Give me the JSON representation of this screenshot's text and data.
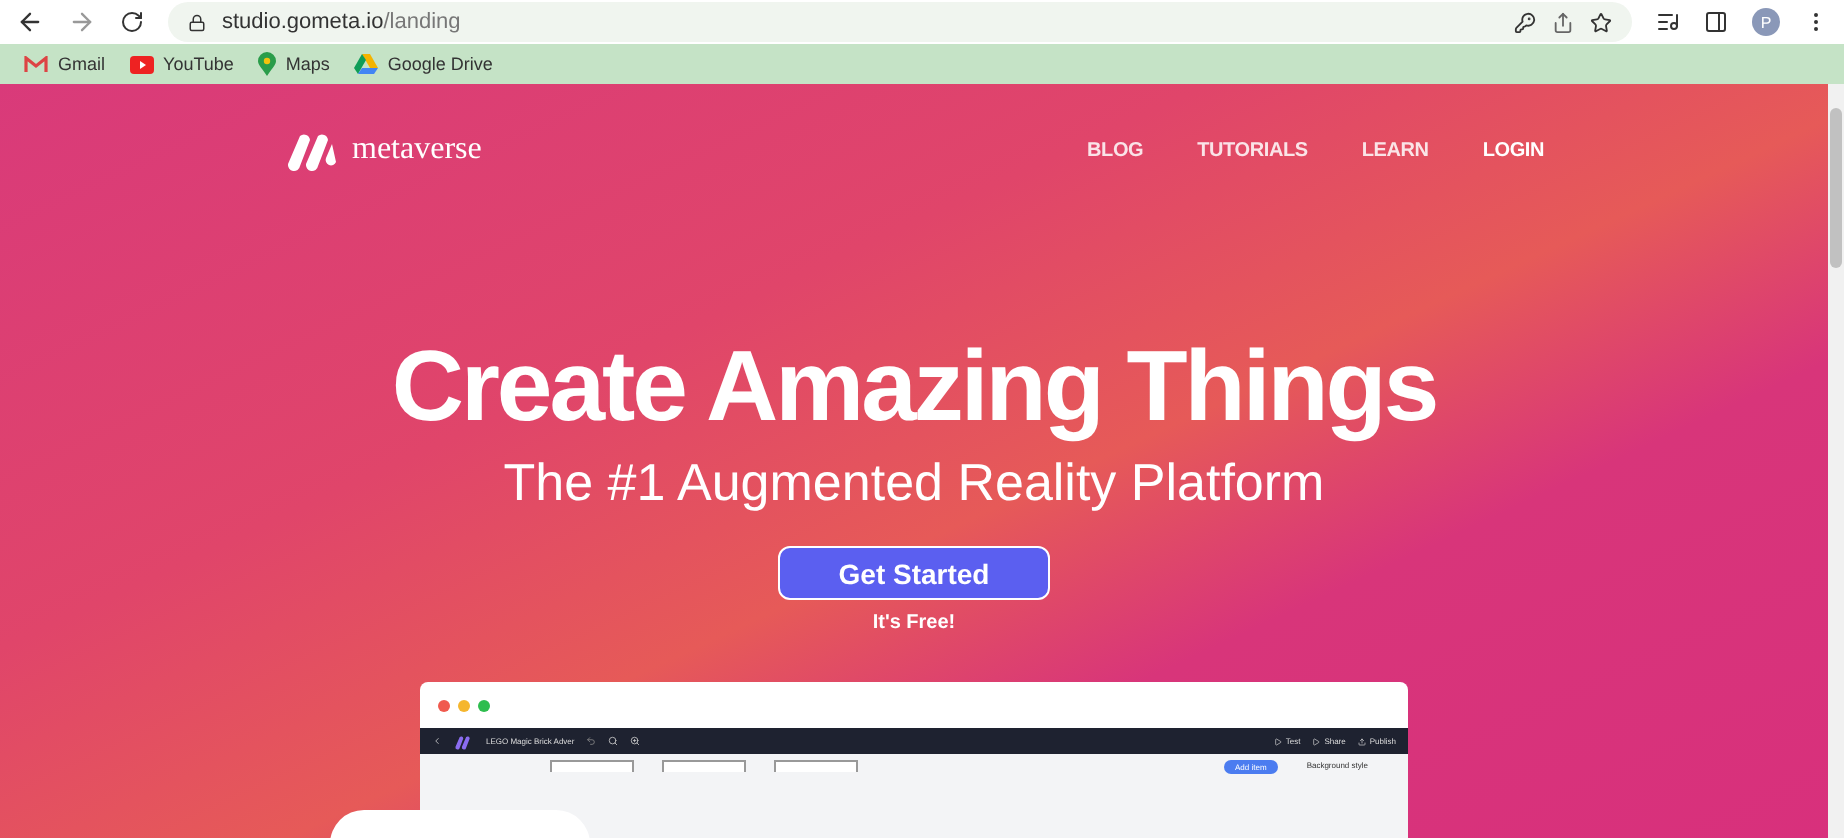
{
  "browser": {
    "url_host": "studio.gometa.io",
    "url_path": "/landing",
    "profile_initial": "P"
  },
  "bookmarks": [
    {
      "label": "Gmail",
      "kind": "gmail"
    },
    {
      "label": "YouTube",
      "kind": "youtube"
    },
    {
      "label": "Maps",
      "kind": "maps"
    },
    {
      "label": "Google Drive",
      "kind": "drive"
    }
  ],
  "nav": {
    "brand": "metaverse",
    "links": [
      {
        "label": "BLOG",
        "selected": false
      },
      {
        "label": "TUTORIALS",
        "selected": false
      },
      {
        "label": "LEARN",
        "selected": false
      },
      {
        "label": "LOGIN",
        "selected": true
      }
    ]
  },
  "hero": {
    "title": "Create Amazing Things",
    "subtitle": "The #1 Augmented Reality Platform",
    "cta": "Get Started",
    "note": "It's Free!"
  },
  "preview": {
    "project": "LEGO Magic Brick Adver",
    "actions": [
      "Test",
      "Share",
      "Publish"
    ],
    "add_button": "Add item",
    "panel_label": "Background style"
  }
}
